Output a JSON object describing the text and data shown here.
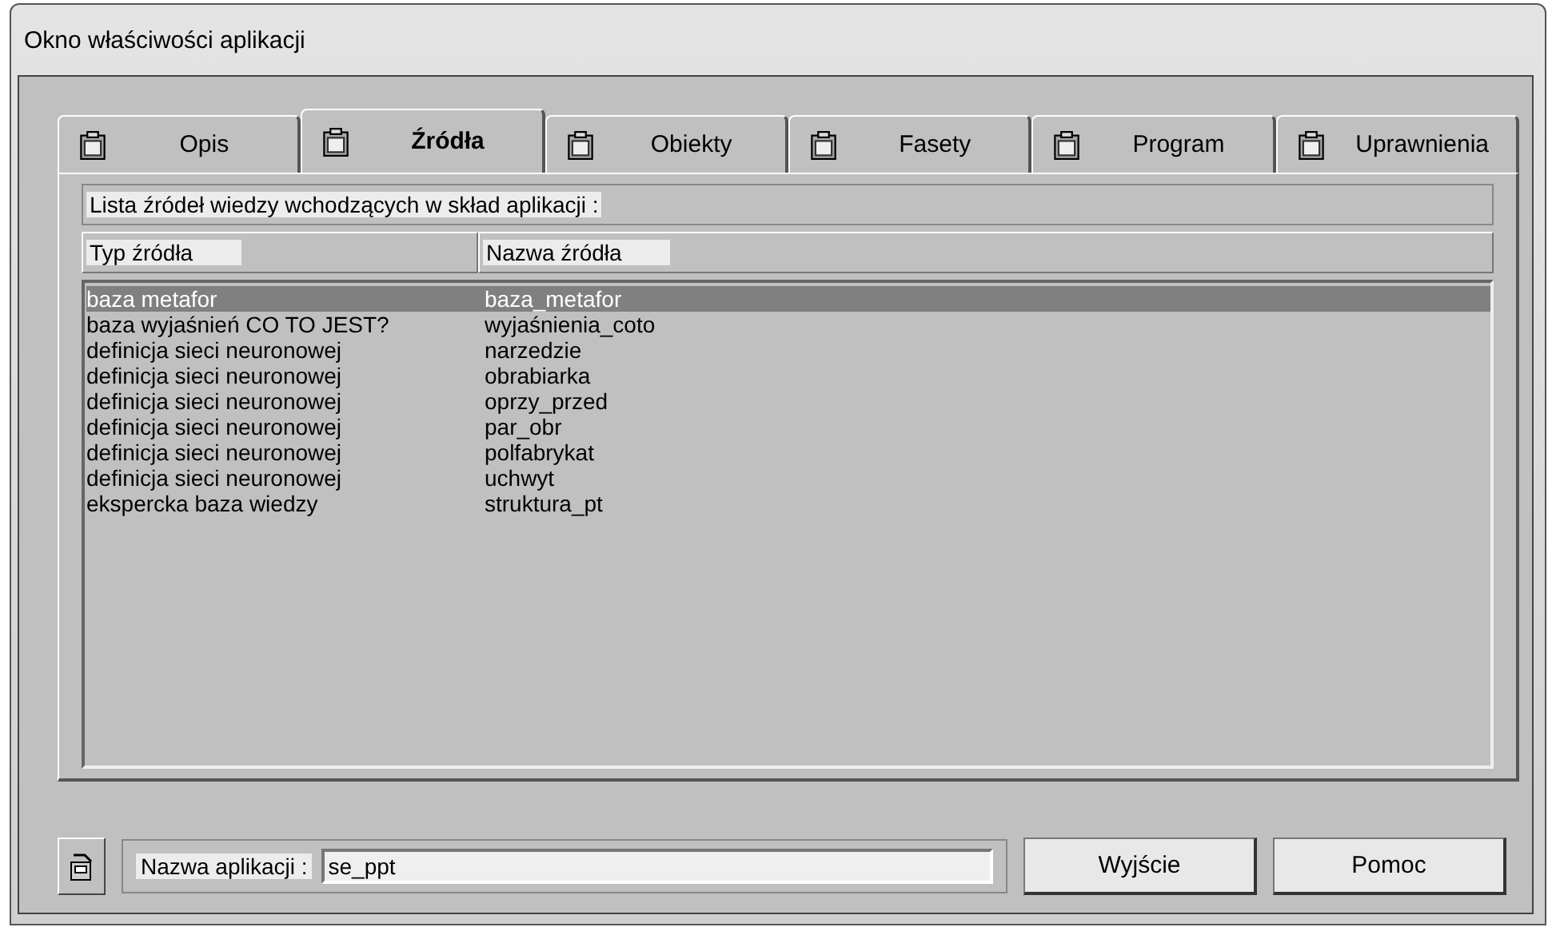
{
  "window": {
    "title": "Okno właściwości aplikacji"
  },
  "tabs": [
    {
      "label": "Opis",
      "selected": false
    },
    {
      "label": "Źródła",
      "selected": true
    },
    {
      "label": "Obiekty",
      "selected": false
    },
    {
      "label": "Fasety",
      "selected": false
    },
    {
      "label": "Program",
      "selected": false
    },
    {
      "label": "Uprawnienia",
      "selected": false
    }
  ],
  "list_caption": "Lista źródeł wiedzy wchodzących w skład aplikacji :",
  "table": {
    "columns": [
      "Typ źródła",
      "Nazwa źródła"
    ],
    "rows": [
      {
        "cells": [
          "baza metafor",
          "baza_metafor"
        ],
        "selected": true
      },
      {
        "cells": [
          "baza wyjaśnień CO TO JEST?",
          "wyjaśnienia_coto"
        ],
        "selected": false
      },
      {
        "cells": [
          "definicja sieci neuronowej",
          "narzedzie"
        ],
        "selected": false
      },
      {
        "cells": [
          "definicja sieci neuronowej",
          "obrabiarka"
        ],
        "selected": false
      },
      {
        "cells": [
          "definicja sieci neuronowej",
          "oprzy_przed"
        ],
        "selected": false
      },
      {
        "cells": [
          "definicja sieci neuronowej",
          "par_obr"
        ],
        "selected": false
      },
      {
        "cells": [
          "definicja sieci neuronowej",
          "polfabrykat"
        ],
        "selected": false
      },
      {
        "cells": [
          "definicja sieci neuronowej",
          "uchwyt"
        ],
        "selected": false
      },
      {
        "cells": [
          "ekspercka baza wiedzy",
          "struktura_pt"
        ],
        "selected": false
      }
    ]
  },
  "app_name": {
    "label": "Nazwa aplikacji :",
    "value": "se_ppt"
  },
  "buttons": [
    "Wyjście",
    "Pomoc"
  ]
}
